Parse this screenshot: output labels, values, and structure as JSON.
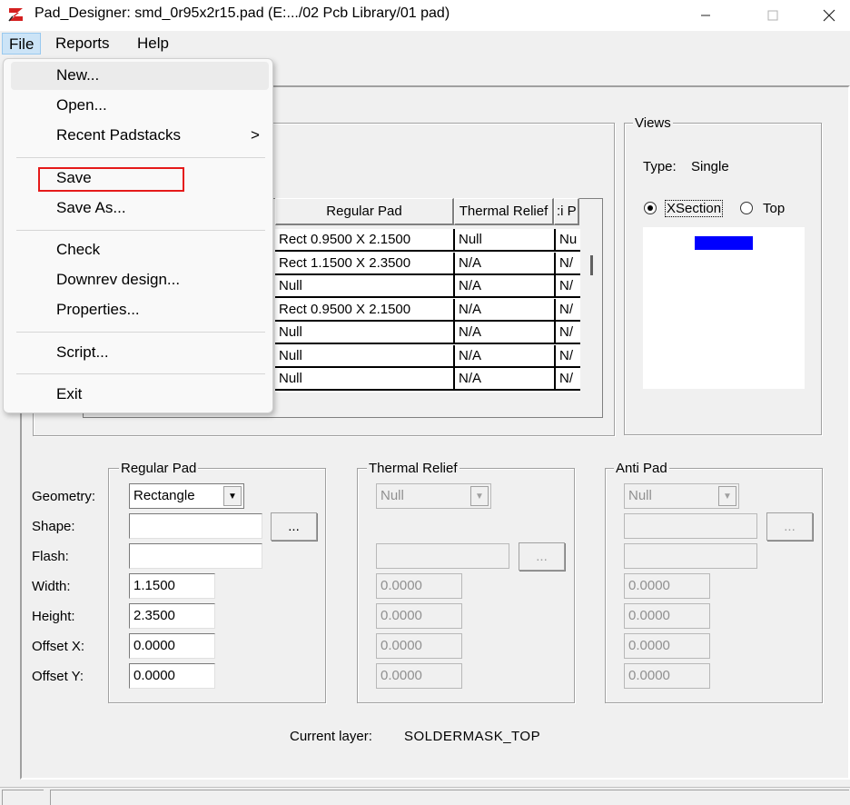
{
  "window": {
    "title": "Pad_Designer: smd_0r95x2r15.pad (E:.../02 Pcb Library/01 pad)",
    "app_icon": "pad-designer-logo-icon",
    "minimize_icon": "minimize-icon",
    "maximize_icon": "maximize-icon",
    "close_icon": "close-icon"
  },
  "menubar": {
    "file": "File",
    "reports": "Reports",
    "help": "Help"
  },
  "file_menu": {
    "items": [
      {
        "label": "New..."
      },
      {
        "label": "Open..."
      },
      {
        "label": "Recent Padstacks",
        "arrow": ">"
      },
      {
        "label": "Save",
        "highlighted": true
      },
      {
        "label": "Save As..."
      },
      {
        "label": "Check"
      },
      {
        "label": "Downrev design..."
      },
      {
        "label": "Properties..."
      },
      {
        "label": "Script..."
      },
      {
        "label": "Exit"
      }
    ]
  },
  "layers_table": {
    "columns": [
      "Regular Pad",
      "Thermal Relief",
      ":i P"
    ],
    "rows": [
      [
        "Rect 0.9500 X 2.1500",
        "Null",
        "Nu"
      ],
      [
        "Rect 1.1500 X 2.3500",
        "N/A",
        "N/"
      ],
      [
        "Null",
        "N/A",
        "N/"
      ],
      [
        "Rect 0.9500 X 2.1500",
        "N/A",
        "N/"
      ],
      [
        "Null",
        "N/A",
        "N/"
      ],
      [
        "Null",
        "N/A",
        "N/"
      ],
      [
        "Null",
        "N/A",
        "N/"
      ]
    ]
  },
  "views": {
    "title": "Views",
    "type_label": "Type:",
    "type_value": "Single",
    "xsection_label": "XSection",
    "top_label": "Top",
    "selected": "XSection",
    "pad_color": "#0000ff"
  },
  "regular_pad": {
    "title": "Regular Pad",
    "geometry_label": "Geometry:",
    "geometry_value": "Rectangle",
    "shape_label": "Shape:",
    "shape_value": "",
    "flash_label": "Flash:",
    "flash_value": "",
    "width_label": "Width:",
    "width_value": "1.1500",
    "height_label": "Height:",
    "height_value": "2.3500",
    "offset_x_label": "Offset X:",
    "offset_x_value": "0.0000",
    "offset_y_label": "Offset Y:",
    "offset_y_value": "0.0000",
    "browse_label": "..."
  },
  "thermal_relief": {
    "title": "Thermal Relief",
    "geometry_value": "Null",
    "width_value": "0.0000",
    "height_value": "0.0000",
    "offset_x_value": "0.0000",
    "offset_y_value": "0.0000",
    "browse_label": "..."
  },
  "anti_pad": {
    "title": "Anti Pad",
    "geometry_value": "Null",
    "width_value": "0.0000",
    "height_value": "0.0000",
    "offset_x_value": "0.0000",
    "offset_y_value": "0.0000",
    "browse_label": "..."
  },
  "current_layer": {
    "label": "Current layer:",
    "value": "SOLDERMASK_TOP"
  },
  "colors": {
    "highlight_box": "#e51a1a",
    "menu_selected": "#cce4f7"
  }
}
